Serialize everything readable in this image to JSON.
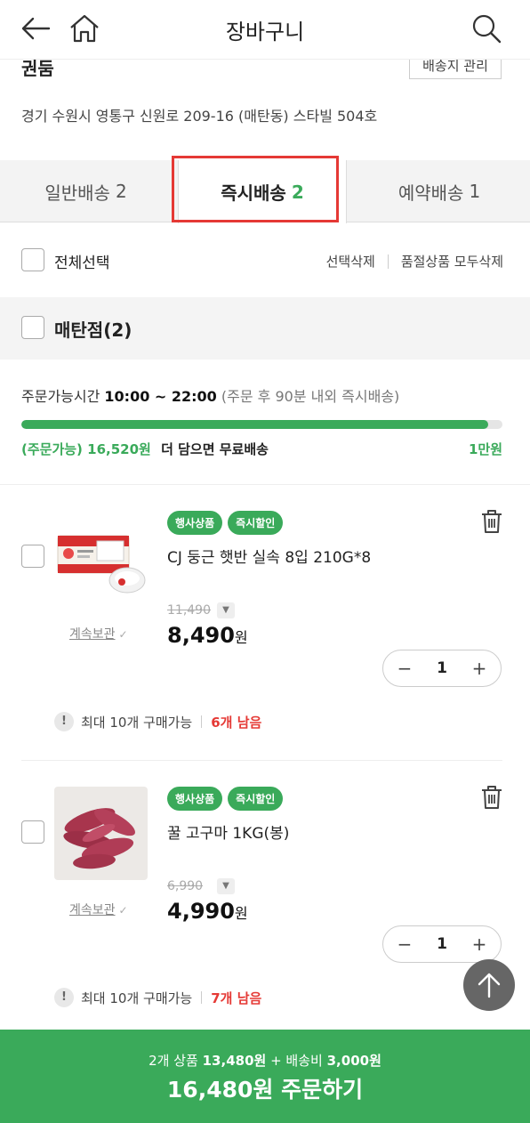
{
  "header": {
    "title": "장바구니"
  },
  "address": {
    "name": "권둠",
    "manage_label": "배송지 관리",
    "line": "경기 수원시 영통구 신원로 209-16 (매탄동) 스타빌 504호"
  },
  "tabs": [
    {
      "label": "일반배송",
      "count": "2"
    },
    {
      "label": "즉시배송",
      "count": "2",
      "active": true
    },
    {
      "label": "예약배송",
      "count": "1"
    }
  ],
  "select_bar": {
    "select_all": "전체선택",
    "delete_selected": "선택삭제",
    "delete_soldout": "품절상품 모두삭제"
  },
  "store": {
    "label": "매탄점(2)"
  },
  "delivery": {
    "time_prefix": "주문가능시간 ",
    "time_range": "10:00 ~ 22:00",
    "time_suffix": " (주문 후 90분 내외 즉시배송)",
    "progress": 0.97,
    "status": "(주문가능)",
    "remaining": "16,520원",
    "message": "더 담으면 무료배송",
    "goal": "1만원"
  },
  "items": [
    {
      "badges": [
        "행사상품",
        "즉시할인"
      ],
      "name": "CJ 둥근 햇반 실속 8입 210G*8",
      "keep_label": "계속보관",
      "original_price": "11,490",
      "price": "8,490",
      "won": "원",
      "qty": "1",
      "limit": "최대 10개 구매가능",
      "remain": "6개 남음"
    },
    {
      "badges": [
        "행사상품",
        "즉시할인"
      ],
      "name": "꿀 고구마 1KG(봉)",
      "keep_label": "계속보관",
      "original_price": "6,990",
      "price": "4,990",
      "won": "원",
      "qty": "1",
      "limit": "최대 10개 구매가능",
      "remain": "7개 남음"
    }
  ],
  "order": {
    "summary_count": "2개 상품",
    "summary_price": "13,480원",
    "summary_plus": "+ 배송비",
    "summary_ship": "3,000원",
    "cta": "16,480원 주문하기"
  },
  "colors": {
    "accent": "#3aaa5a",
    "alert": "#e53935"
  }
}
